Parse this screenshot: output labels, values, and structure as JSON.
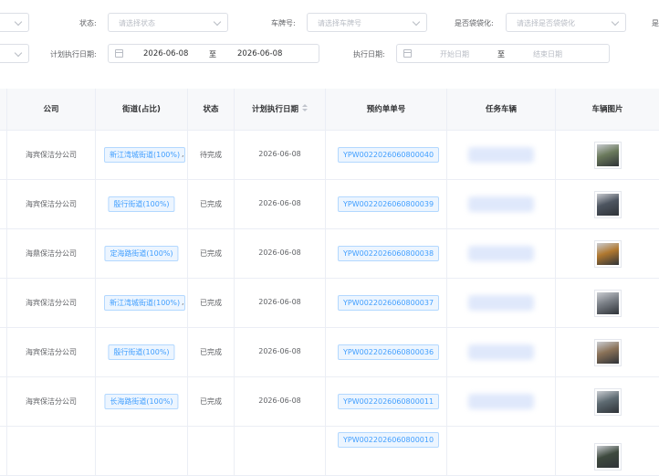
{
  "filters": {
    "status_label": "状态:",
    "status_placeholder": "请选择状态",
    "plate_label": "车牌号:",
    "plate_placeholder": "请选择车牌号",
    "bagged_label": "是否袋袋化:",
    "bagged_placeholder": "请选择是否袋袋化",
    "trailing_label": "是",
    "plan_date_label": "计划执行日期:",
    "plan_date_start": "2026-06-08",
    "plan_date_sep": "至",
    "plan_date_end": "2026-06-08",
    "exec_date_label": "执行日期:",
    "exec_date_start_placeholder": "开始日期",
    "exec_date_sep": "至",
    "exec_date_end_placeholder": "结束日期"
  },
  "table": {
    "headers": {
      "company": "公司",
      "street": "街道(占比)",
      "status": "状态",
      "plan_date": "计划执行日期",
      "order_no": "预约单单号",
      "vehicle": "任务车辆",
      "photo": "车辆图片"
    },
    "rows": [
      {
        "company": "海宾保洁分公司",
        "street": "新江湾城街道(100%)",
        "street_more": ",",
        "status": "待完成",
        "date": "2026-06-08",
        "order": "YPW0022026060800040",
        "photo_color": "#6b7a5c"
      },
      {
        "company": "海宾保洁分公司",
        "street": "殷行街道(100%)",
        "street_more": "",
        "status": "已完成",
        "date": "2026-06-08",
        "order": "YPW0022026060800039",
        "photo_color": "#4d5560"
      },
      {
        "company": "海鼎保洁分公司",
        "street": "定海路街道(100%)",
        "street_more": "",
        "status": "已完成",
        "date": "2026-06-08",
        "order": "YPW0022026060800038",
        "photo_color": "#b0782f"
      },
      {
        "company": "海宾保洁分公司",
        "street": "新江湾城街道(100%)",
        "street_more": ",",
        "status": "已完成",
        "date": "2026-06-08",
        "order": "YPW0022026060800037",
        "photo_color": "#7a7f86"
      },
      {
        "company": "海宾保洁分公司",
        "street": "殷行街道(100%)",
        "street_more": "",
        "status": "已完成",
        "date": "2026-06-08",
        "order": "YPW0022026060800036",
        "photo_color": "#8a7258"
      },
      {
        "company": "海宾保洁分公司",
        "street": "长海路街道(100%)",
        "street_more": "",
        "status": "已完成",
        "date": "2026-06-08",
        "order": "YPW0022026060800011",
        "photo_color": "#5e6b72"
      },
      {
        "company": "",
        "street": "",
        "street_more": "",
        "status": "",
        "date": "",
        "order": "YPW0022026060800010",
        "photo_color": "#3e4a3e"
      }
    ]
  }
}
